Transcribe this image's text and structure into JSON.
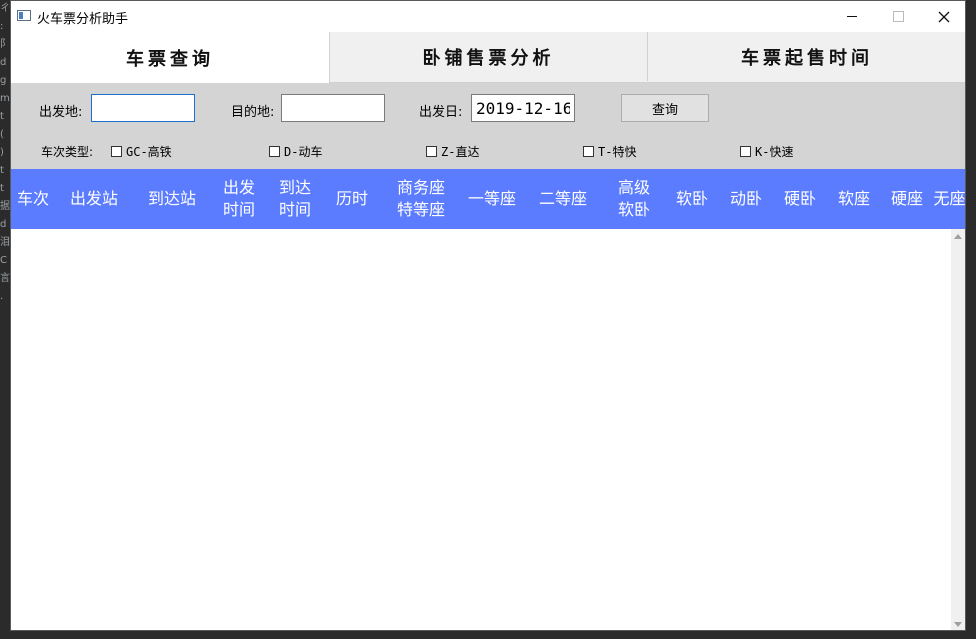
{
  "window": {
    "title": "火车票分析助手",
    "icon": "app-window-icon"
  },
  "tabs": [
    {
      "label": "车票查询",
      "active": true
    },
    {
      "label": "卧铺售票分析",
      "active": false
    },
    {
      "label": "车票起售时间",
      "active": false
    }
  ],
  "filter": {
    "from_label": "出发地:",
    "from_value": "",
    "to_label": "目的地:",
    "to_value": "",
    "date_label": "出发日:",
    "date_value": "2019-12-16",
    "query_label": "查询",
    "type_label": "车次类型:",
    "types": [
      {
        "label": "GC-高铁",
        "checked": false
      },
      {
        "label": "D-动车",
        "checked": false
      },
      {
        "label": "Z-直达",
        "checked": false
      },
      {
        "label": "T-特快",
        "checked": false
      },
      {
        "label": "K-快速",
        "checked": false
      }
    ]
  },
  "table": {
    "header_color": "#5b7cff",
    "columns": [
      {
        "l1": "车次",
        "l2": ""
      },
      {
        "l1": "出发站",
        "l2": ""
      },
      {
        "l1": "到达站",
        "l2": ""
      },
      {
        "l1": "出发",
        "l2": "时间"
      },
      {
        "l1": "到达",
        "l2": "时间"
      },
      {
        "l1": "历时",
        "l2": ""
      },
      {
        "l1": "商务座",
        "l2": "特等座"
      },
      {
        "l1": "一等座",
        "l2": ""
      },
      {
        "l1": "二等座",
        "l2": ""
      },
      {
        "l1": "高级",
        "l2": "软卧"
      },
      {
        "l1": "软卧",
        "l2": ""
      },
      {
        "l1": "动卧",
        "l2": ""
      },
      {
        "l1": "硬卧",
        "l2": ""
      },
      {
        "l1": "软座",
        "l2": ""
      },
      {
        "l1": "硬座",
        "l2": ""
      },
      {
        "l1": "无座",
        "l2": ""
      }
    ],
    "rows": []
  },
  "background_text": [
    "ㄔ",
    ":",
    "阝",
    "d",
    "g",
    "",
    "m",
    "t",
    "(",
    ")",
    "t",
    "t",
    "据",
    "d",
    "泪",
    "C",
    "言",
    "."
  ]
}
